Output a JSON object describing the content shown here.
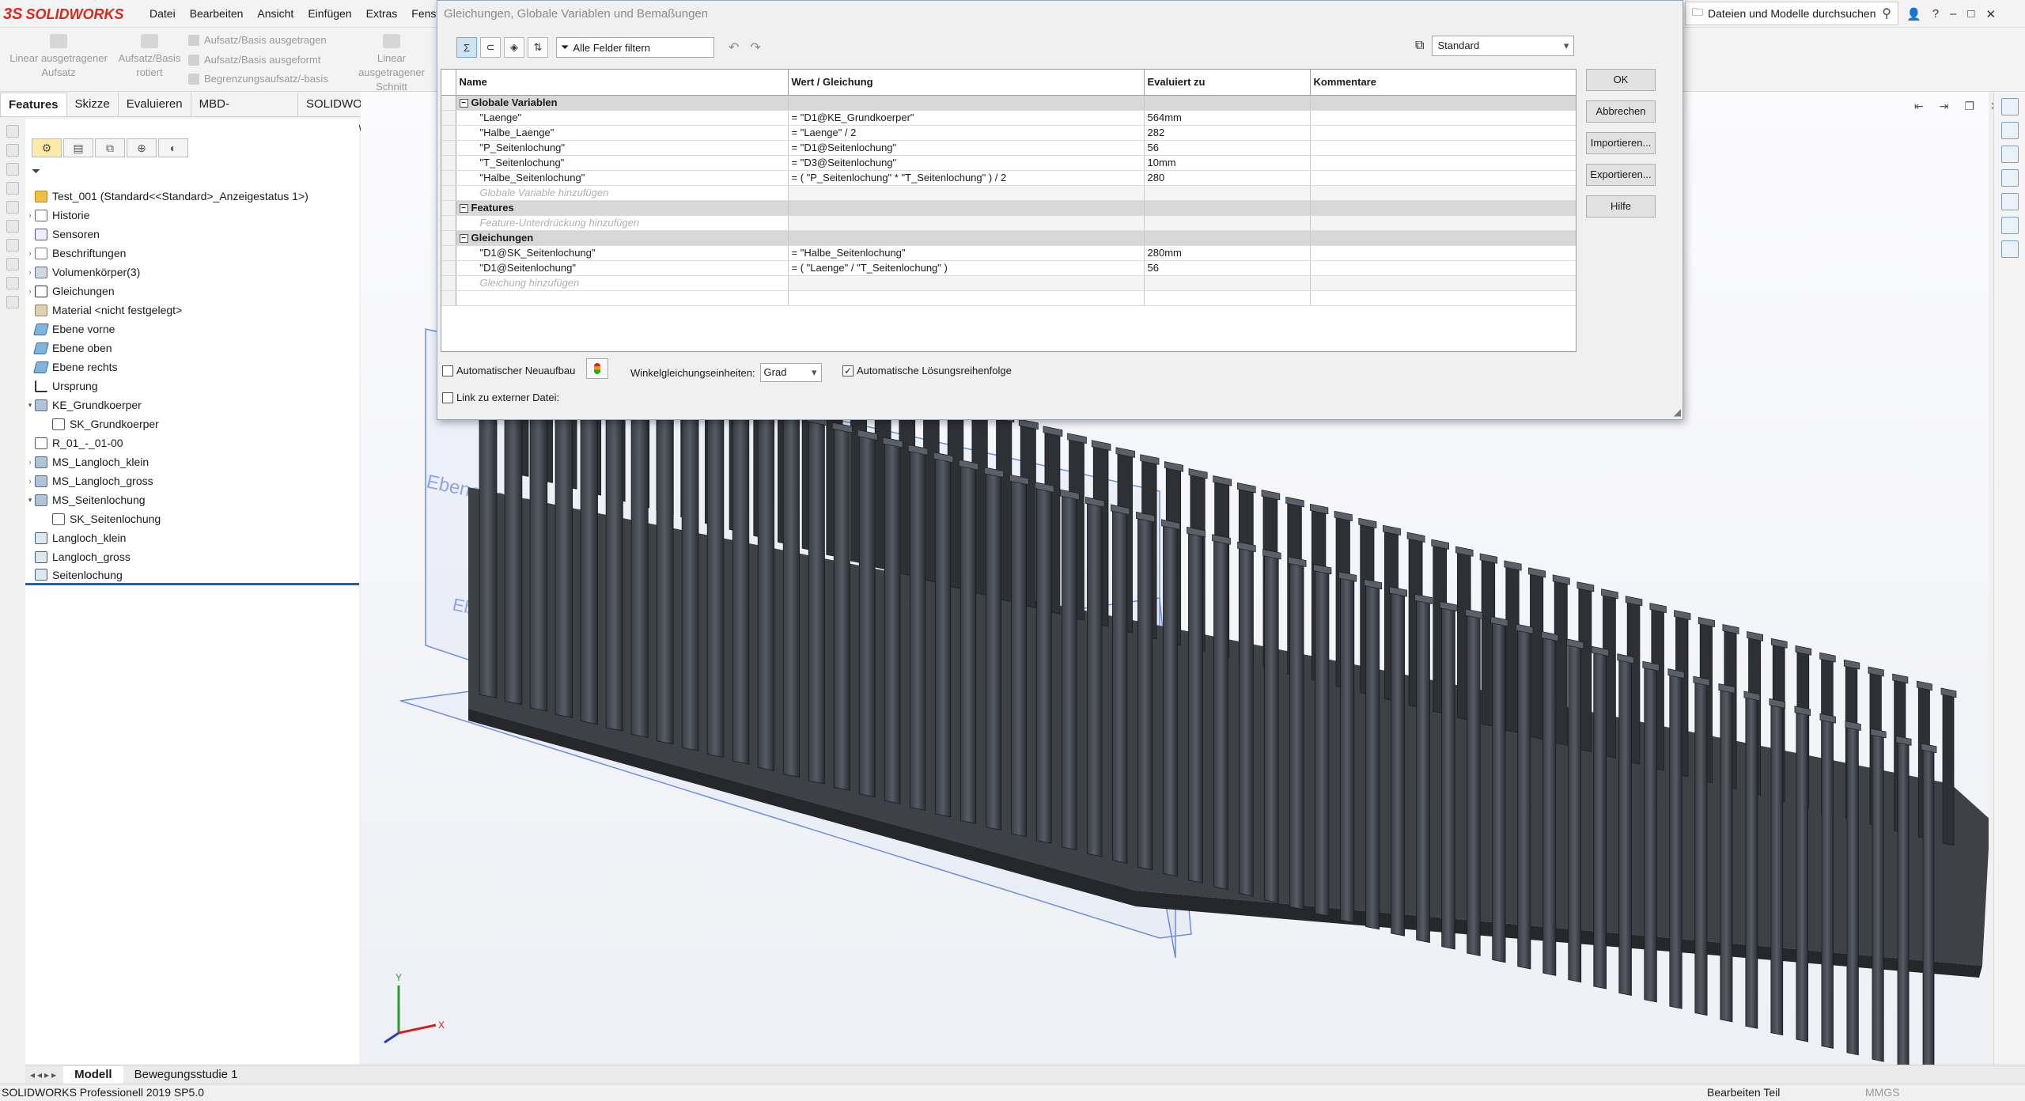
{
  "app": {
    "name": "SOLIDWORKS",
    "logo_prefix": "3S"
  },
  "menu": [
    "Datei",
    "Bearbeiten",
    "Ansicht",
    "Einfügen",
    "Extras",
    "Fenster"
  ],
  "search": {
    "placeholder": "Dateien und Modelle durchsuchen"
  },
  "system": {
    "help": "?",
    "min": "–",
    "max": "□",
    "close": "✕"
  },
  "commands": {
    "boss_extrude": "Linear ausgetragener Aufsatz",
    "revolve": "Aufsatz/Basis rotiert",
    "sweep": "Aufsatz/Basis ausgetragen",
    "loft": "Aufsatz/Basis ausgeformt",
    "boundary": "Begrenzungsaufsatz/-basis",
    "cut_extrude": "Linear ausgetragener Schnitt"
  },
  "tabs": [
    "Features",
    "Skizze",
    "Evaluieren",
    "MBD-Dimensionen",
    "SOLIDWORKS Zusatzanw"
  ],
  "tree": {
    "root": "Test_001  (Standard<<Standard>_Anzeigestatus 1>)",
    "items": [
      {
        "label": "Historie",
        "icon": "history-icon",
        "expand": "›"
      },
      {
        "label": "Sensoren",
        "icon": "sensor-icon",
        "expand": ""
      },
      {
        "label": "Beschriftungen",
        "icon": "annotation-icon",
        "expand": "›"
      },
      {
        "label": "Volumenkörper(3)",
        "icon": "solid-bodies-icon",
        "expand": "›"
      },
      {
        "label": "Gleichungen",
        "icon": "equations-icon",
        "expand": "›"
      },
      {
        "label": "Material <nicht festgelegt>",
        "icon": "material-icon",
        "expand": ""
      },
      {
        "label": "Ebene vorne",
        "icon": "plane-icon",
        "expand": ""
      },
      {
        "label": "Ebene oben",
        "icon": "plane-icon",
        "expand": ""
      },
      {
        "label": "Ebene rechts",
        "icon": "plane-icon",
        "expand": ""
      },
      {
        "label": "Ursprung",
        "icon": "origin-icon",
        "expand": ""
      },
      {
        "label": "KE_Grundkoerper",
        "icon": "extrude-feature-icon",
        "expand": "▾"
      },
      {
        "label": "SK_Grundkoerper",
        "icon": "sketch-icon",
        "expand": "",
        "indent": true
      },
      {
        "label": "R_01_-_01-00",
        "icon": "sketch-icon",
        "expand": ""
      },
      {
        "label": "MS_Langloch_klein",
        "icon": "cut-feature-icon",
        "expand": "›"
      },
      {
        "label": "MS_Langloch_gross",
        "icon": "cut-feature-icon",
        "expand": "›"
      },
      {
        "label": "MS_Seitenlochung",
        "icon": "cut-feature-icon",
        "expand": "▾"
      },
      {
        "label": "SK_Seitenlochung",
        "icon": "sketch-icon",
        "expand": "",
        "indent": true
      },
      {
        "label": "Langloch_klein",
        "icon": "pattern-icon",
        "expand": ""
      },
      {
        "label": "Langloch_gross",
        "icon": "pattern-icon",
        "expand": ""
      },
      {
        "label": "Seitenlochung",
        "icon": "pattern-icon",
        "expand": "",
        "selected": true
      }
    ]
  },
  "viewport": {
    "plane_front": "Ebene vorne",
    "plane_top": "Ebene oben",
    "axis_x": "X",
    "axis_y": "Y"
  },
  "bottom_tabs": [
    "Modell",
    "Bewegungsstudie 1"
  ],
  "status": {
    "version": "SOLIDWORKS Professionell 2019 SP5.0",
    "mode": "Bearbeiten Teil",
    "units": "MMGS"
  },
  "dialog": {
    "title": "Gleichungen, Globale Variablen und Bemaßungen",
    "filter_placeholder": "Alle Felder filtern",
    "config": "Standard",
    "columns": [
      "Name",
      "Wert / Gleichung",
      "Evaluiert zu",
      "Kommentare"
    ],
    "sections": {
      "globals": "Globale Variablen",
      "features": "Features",
      "equations": "Gleichungen"
    },
    "globals": [
      {
        "name": "\"Laenge\"",
        "value": "= \"D1@KE_Grundkoerper\"",
        "eval": "564mm",
        "comment": ""
      },
      {
        "name": "\"Halbe_Laenge\"",
        "value": "= \"Laenge\" / 2",
        "eval": "282",
        "comment": ""
      },
      {
        "name": "\"P_Seitenlochung\"",
        "value": "= \"D1@Seitenlochung\"",
        "eval": "56",
        "comment": ""
      },
      {
        "name": "\"T_Seitenlochung\"",
        "value": "= \"D3@Seitenlochung\"",
        "eval": "10mm",
        "comment": ""
      },
      {
        "name": "\"Halbe_Seitenlochung\"",
        "value": "= ( \"P_Seitenlochung\" * \"T_Seitenlochung\" ) / 2",
        "eval": "280",
        "comment": ""
      }
    ],
    "add_global": "Globale Variable hinzufügen",
    "add_feature": "Feature-Unterdrückung hinzufügen",
    "equations": [
      {
        "name": "\"D1@SK_Seitenlochung\"",
        "value": "= \"Halbe_Seitenlochung\"",
        "eval": "280mm",
        "comment": ""
      },
      {
        "name": "\"D1@Seitenlochung\"",
        "value": "= ( \"Laenge\" / \"T_Seitenlochung\" )",
        "eval": "56",
        "comment": ""
      }
    ],
    "add_equation": "Gleichung hinzufügen",
    "buttons": {
      "ok": "OK",
      "cancel": "Abbrechen",
      "import": "Importieren...",
      "export": "Exportieren...",
      "help": "Hilfe"
    },
    "auto_rebuild": "Automatischer Neuaufbau",
    "angle_units_label": "Winkelgleichungseinheiten:",
    "angle_units": "Grad",
    "auto_solve": "Automatische Lösungsreihenfolge",
    "link_external": "Link zu externer Datei:"
  }
}
